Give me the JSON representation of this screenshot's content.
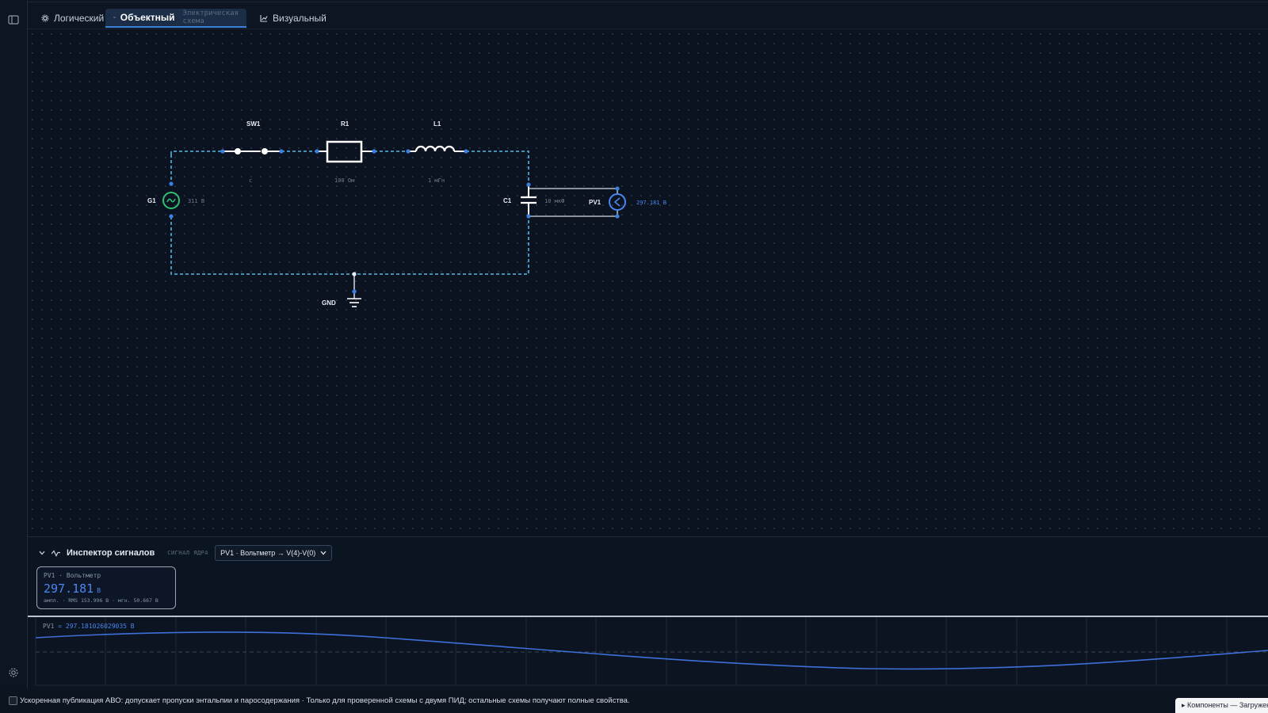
{
  "tabs": [
    {
      "label": "Логический",
      "icon": "gear-icon"
    },
    {
      "label": "Объектный",
      "sub": "Электрическая схема",
      "icon": "wave-icon"
    },
    {
      "label": "Визуальный",
      "icon": "chart-icon"
    }
  ],
  "schematic": {
    "components": [
      {
        "id": "SW1",
        "value": "с"
      },
      {
        "id": "R1",
        "value": "100 Ом"
      },
      {
        "id": "L1",
        "value": "1 мГн"
      },
      {
        "id": "G1",
        "value": "311 В"
      },
      {
        "id": "C1",
        "value": "10 мкФ"
      },
      {
        "id": "PV1",
        "value": "297.181 В"
      },
      {
        "id": "GND",
        "value": ""
      }
    ]
  },
  "inspector": {
    "title": "Инспектор сигналов",
    "kernel_label": "СИГНАЛ ЯДРА",
    "selected_signal": "PV1 · Вольтметр → V(4)-V(0)",
    "card": {
      "label": "PV1 · Вольтметр",
      "value": "297.181",
      "unit": "В",
      "stats": "ампл. · RMS 153.996 В · мгн. 50.667 В"
    }
  },
  "scope": {
    "label_name": "PV1",
    "label_value": "= 297.181026029035 В"
  },
  "footer": {
    "text": "Ускоренная публикация АВО: допускает пропуски энтальпии и паросодержания · Только для проверенной схемы с двумя ПИД; остальные схемы получают полные свойства.",
    "components_label": "▸ Компоненты — Загружены"
  },
  "colors": {
    "accent": "#4a86f0",
    "wire": "#4aa3c8",
    "source": "#2fbf71"
  }
}
